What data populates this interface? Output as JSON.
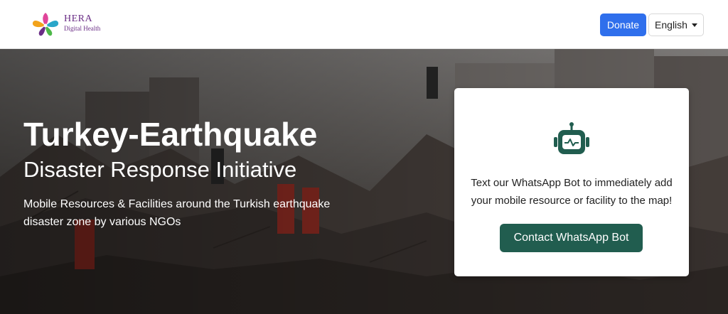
{
  "nav": {
    "logo_name": "HERA",
    "logo_sub": "Digital Health",
    "donate_label": "Donate",
    "language_label": "English"
  },
  "hero": {
    "title": "Turkey-Earthquake",
    "subtitle": "Disaster Response Initiative",
    "description": "Mobile Resources & Facilities around the Turkish earthquake disaster zone by various NGOs"
  },
  "card": {
    "text": "Text our WhatsApp Bot to immediately add your mobile resource or facility to the map!",
    "button_label": "Contact WhatsApp Bot"
  },
  "colors": {
    "donate": "#2f6fec",
    "whatsapp_button": "#215d4f",
    "bot_icon": "#215d4f",
    "logo_text": "#6a2d86"
  },
  "icons": {
    "logo": "hera-flower-logo",
    "bot": "robot-icon",
    "dropdown": "caret-down-icon"
  }
}
